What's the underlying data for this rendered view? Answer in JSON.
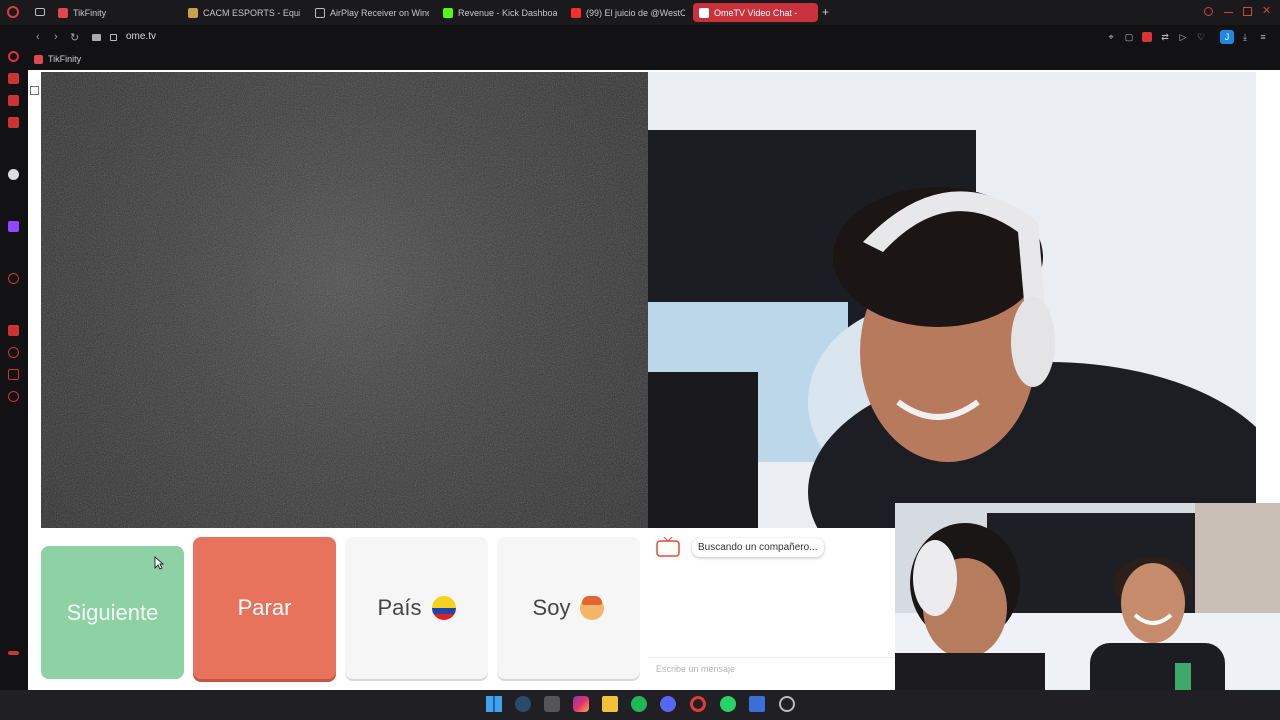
{
  "tabs": [
    {
      "label": "TikFinity",
      "color": "#e0474f"
    },
    {
      "label": "CACM ESPORTS - Equip",
      "color": "#c9a04a"
    },
    {
      "label": "AirPlay Receiver on Wind",
      "color": "#9aa0a6"
    },
    {
      "label": "Revenue - Kick Dashboa",
      "color": "#53fc18"
    },
    {
      "label": "(99) El juicio de @WestC",
      "color": "#ff2b2b"
    },
    {
      "label": "OmeTV Video Chat -",
      "color": "#ffffff",
      "active": true
    }
  ],
  "new_tab_label": "+",
  "address": {
    "url": "ome.tv"
  },
  "bookmarks": [
    {
      "label": "TikFinity"
    }
  ],
  "buttons": {
    "next": "Siguiente",
    "stop": "Parar",
    "country": "País",
    "gender": "Soy"
  },
  "chat": {
    "status": "Buscando un compañero...",
    "placeholder": "Escribe un mensaje"
  },
  "profile_initial": "J",
  "colors": {
    "accent_tab": "#c9313c",
    "next_button": "#8dd1a4",
    "stop_button": "#e8735c"
  }
}
